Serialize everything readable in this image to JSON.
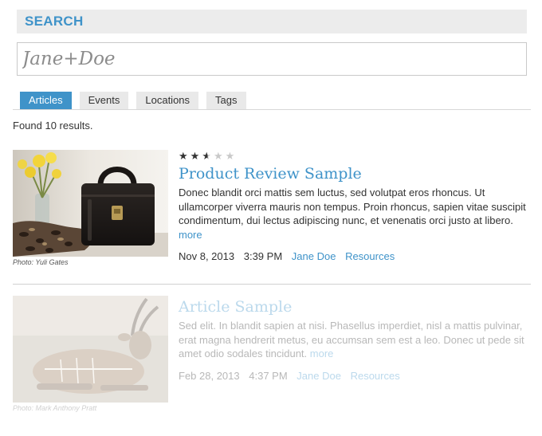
{
  "search": {
    "header": "SEARCH",
    "query": "Jane+Doe"
  },
  "tabs": [
    {
      "label": "Articles",
      "active": true
    },
    {
      "label": "Events",
      "active": false
    },
    {
      "label": "Locations",
      "active": false
    },
    {
      "label": "Tags",
      "active": false
    }
  ],
  "results_summary": "Found 10 results.",
  "results": [
    {
      "rating": 2.5,
      "rating_max": 5,
      "title": "Product Review Sample",
      "summary": "Donec blandit orci mattis sem luctus, sed volutpat eros rhoncus. Ut ullamcorper viverra mauris non tempus. Proin rhoncus, sapien vitae suscipit condimentum, dui lectus adipiscing nunc, et venenatis orci justo at libero.",
      "more_label": "more",
      "date": "Nov 8, 2013",
      "time": "3:39 PM",
      "author": "Jane Doe",
      "category": "Resources",
      "photo_caption": "Photo: Yuli Gates",
      "image_icon": "leather-bag-photo"
    },
    {
      "title": "Article Sample",
      "summary": "Sed elit. In blandit sapien at nisi. Phasellus imperdiet, nisl a mattis pulvinar, erat magna hendrerit metus, eu accumsan sem est a leo. Donec ut pede sit amet odio sodales tincidunt.",
      "more_label": "more",
      "date": "Feb 28, 2013",
      "time": "4:37 PM",
      "author": "Jane Doe",
      "category": "Resources",
      "photo_caption": "Photo: Mark Anthony Pratt",
      "image_icon": "antelope-photo"
    }
  ],
  "colors": {
    "accent": "#3f93c9",
    "header_bg": "#ececec",
    "text": "#333333"
  }
}
